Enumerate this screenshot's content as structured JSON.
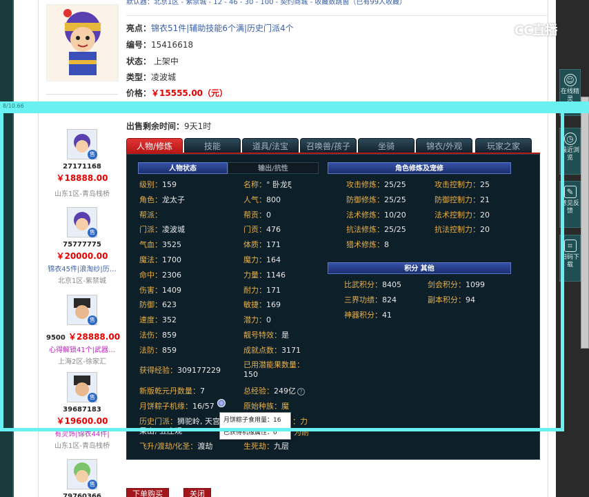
{
  "header": {
    "top_cut_text": "默认器：北京1区 - 紫禁城 - 12 - 46 - 30 - 100 - 契约商城 - 收藏数跳窗（已有99人收藏）"
  },
  "item": {
    "highlight_label": "亮点：",
    "highlight_value": "锦衣51件|辅助技能6个满|历史门派4个",
    "id_label": "编号：",
    "id_value": "15416618",
    "status_label": "状态：",
    "status_value": "上架中",
    "type_label": "类型：",
    "type_value": "凌波城",
    "price_label": "价格：",
    "price_value": "￥15555.00（元）",
    "remain_label": "出售剩余时间：",
    "remain_value": "9天1时"
  },
  "sidebar": {
    "items": [
      {
        "id": "27171168",
        "price": "￥18888.00",
        "tags": "",
        "server": "山东1区-青岛栈桥",
        "badge": "售"
      },
      {
        "id": "75777775",
        "price": "￥20000.00",
        "tags": "锦衣45件|浪淘纱|历…",
        "server": "北京1区-紫禁城",
        "badge": "售"
      },
      {
        "id": "9500",
        "price": "￥28888.00",
        "tags": "心得解锁41个|武器…",
        "server": "上海2区-徐家汇",
        "badge": "售"
      },
      {
        "id": "39687183",
        "price": "￥19600.00",
        "tags": "有灵饰|锦衣44件|",
        "server": "山东1区-青岛栈桥",
        "badge": "售"
      },
      {
        "id": "79760366",
        "price": "",
        "tags": "",
        "server": "",
        "badge": "售"
      }
    ]
  },
  "tabs": [
    {
      "label": "人物/修炼",
      "active": true
    },
    {
      "label": "技能",
      "active": false
    },
    {
      "label": "道具/法宝",
      "active": false
    },
    {
      "label": "召唤兽/孩子",
      "active": false
    },
    {
      "label": "坐骑",
      "active": false
    },
    {
      "label": "锦衣/外观",
      "active": false
    },
    {
      "label": "玩家之家",
      "active": false
    }
  ],
  "game_panel": {
    "headers": {
      "char_status": "人物状态",
      "output_resist": "输出/抗性",
      "cultivation": "角色修炼及宠修",
      "points": "积分 其他"
    },
    "left_col": [
      {
        "k": "级别：",
        "v": "159"
      },
      {
        "k": "角色：",
        "v": "龙太子"
      },
      {
        "k": "帮派：",
        "v": ""
      },
      {
        "k": "门派：",
        "v": "凌波城"
      },
      {
        "k": "气血：",
        "v": "3525"
      },
      {
        "k": "魔法：",
        "v": "1700"
      },
      {
        "k": "命中：",
        "v": "2306"
      },
      {
        "k": "伤害：",
        "v": "1409"
      },
      {
        "k": "防御：",
        "v": "623"
      },
      {
        "k": "速度：",
        "v": "352"
      },
      {
        "k": "法伤：",
        "v": "859"
      },
      {
        "k": "法防：",
        "v": "859"
      }
    ],
    "mid_col": [
      {
        "k": "名称：",
        "v": "° 卧龙ξ"
      },
      {
        "k": "人气：",
        "v": "800"
      },
      {
        "k": "帮贡：",
        "v": "0"
      },
      {
        "k": "门贡：",
        "v": "476"
      },
      {
        "k": "体质：",
        "v": "171"
      },
      {
        "k": "魔力：",
        "v": "164"
      },
      {
        "k": "力量：",
        "v": "1146"
      },
      {
        "k": "耐力：",
        "v": "171"
      },
      {
        "k": "敏捷：",
        "v": "169"
      },
      {
        "k": "潜力：",
        "v": "0"
      },
      {
        "k": "靓号特效：",
        "v": "是"
      },
      {
        "k": "成就点数：",
        "v": "3171"
      }
    ],
    "exp_label": "获得经验：",
    "exp_value": "309177229",
    "potential_label": "已用潜能果数量：",
    "potential_value": "150",
    "pill_label": "新版乾元丹数量：",
    "pill_value": "7",
    "total_exp_label": "总经验：",
    "total_exp_value": "249亿",
    "zongzi_label": "月饼粽子机缘：",
    "zongzi_value": "16/57",
    "race_label": "原始种族：",
    "race_value": "魔",
    "history_label": "历史门派：",
    "history_value": "狮驼岭, 天宫,",
    "history_value2": "果山, 五庄观",
    "strength_label": "：力",
    "resist_label": "为耐",
    "ascend_label": "飞升/渡劫/化圣：",
    "ascend_value": "渡劫",
    "life_label": "生死劫：",
    "life_value": "九层",
    "cultivation": [
      {
        "k": "攻击修炼：",
        "v": "25/25",
        "k2": "攻击控制力：",
        "v2": "25"
      },
      {
        "k": "防御修炼：",
        "v": "25/25",
        "k2": "防御控制力：",
        "v2": "21"
      },
      {
        "k": "法术修炼：",
        "v": "10/20",
        "k2": "法术控制力：",
        "v2": "20"
      },
      {
        "k": "抗法修炼：",
        "v": "25/25",
        "k2": "抗法控制力：",
        "v2": "20"
      },
      {
        "k": "猎术修炼：",
        "v": "8",
        "k2": "",
        "v2": ""
      }
    ],
    "points": [
      {
        "k": "比武积分：",
        "v": "8405",
        "k2": "剑会积分：",
        "v2": "1099"
      },
      {
        "k": "三界功绩：",
        "v": "824",
        "k2": "副本积分：",
        "v2": "94"
      },
      {
        "k": "神器积分：",
        "v": "41",
        "k2": "",
        "v2": ""
      }
    ]
  },
  "tooltip": {
    "row1_label": "月饼粽子食用量：",
    "row1_value": "16",
    "row2_label": "已获得机缘属性：",
    "row2_value": "0"
  },
  "buttons": {
    "buy": "下单购买",
    "close": "关闭"
  },
  "right_bar": {
    "tools": [
      {
        "label": "在线精灵",
        "icon": "avatar-icon"
      },
      {
        "label": "最近浏览",
        "icon": "clock-icon"
      },
      {
        "label": "意见反馈",
        "icon": "edit-icon"
      },
      {
        "label": "扫码下载",
        "icon": "scan-icon"
      }
    ]
  },
  "overlay": {
    "timestamp": "8/10.66",
    "watermark": "CC直播"
  }
}
